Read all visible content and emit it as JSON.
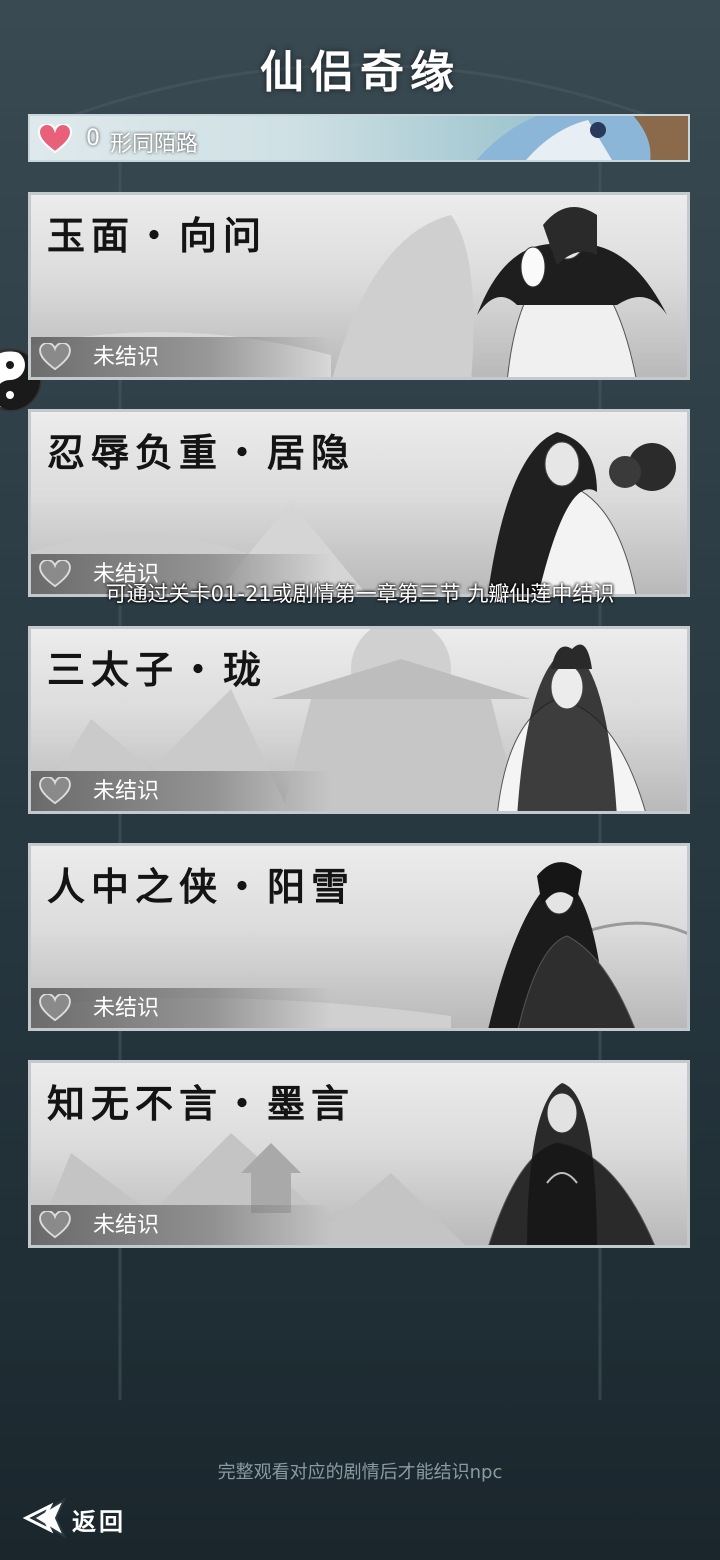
{
  "screen": {
    "title": "仙侣奇缘",
    "relationship": {
      "count": "0",
      "label": "形同陌路",
      "heart_icon": "heart-filled-icon",
      "heart_color": "#e8607a"
    },
    "cards": [
      {
        "name": "玉面・向问",
        "status": "未结识"
      },
      {
        "name": "忍辱负重・居隐",
        "status": "未结识"
      },
      {
        "name": "三太子・珑",
        "status": "未结识"
      },
      {
        "name": "人中之侠・阳雪",
        "status": "未结识"
      },
      {
        "name": "知无不言・墨言",
        "status": "未结识"
      }
    ],
    "tooltip": "可通过关卡01-21或剧情第一章第三节 九瓣仙莲中结识",
    "footer_note": "完整观看对应的剧情后才能结识npc",
    "back_label": "返回"
  }
}
